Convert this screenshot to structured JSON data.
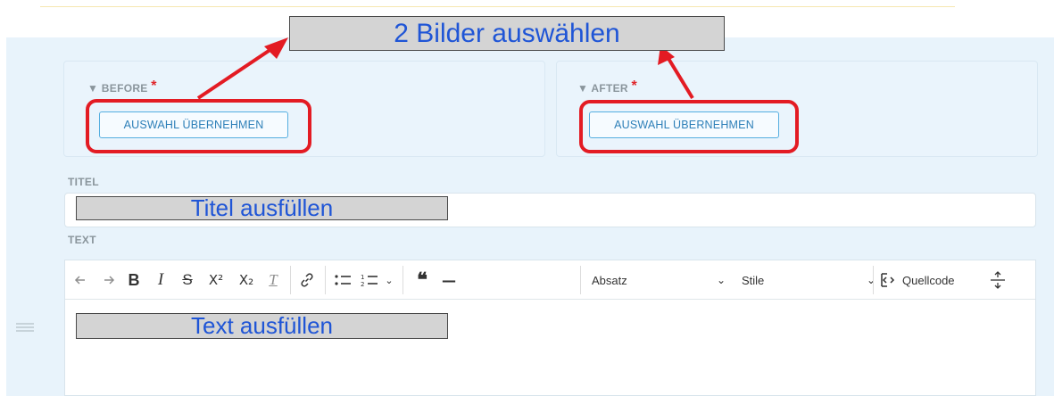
{
  "callouts": {
    "images": "2 Bilder auswählen",
    "title": "Titel ausfüllen",
    "text": "Text ausfüllen"
  },
  "before": {
    "label": "▼ BEFORE",
    "required": "*",
    "button_label": "AUSWAHL ÜBERNEHMEN"
  },
  "after": {
    "label": "▼ AFTER",
    "required": "*",
    "button_label": "AUSWAHL ÜBERNEHMEN"
  },
  "title_section": {
    "label": "TITEL",
    "value": ""
  },
  "text_section": {
    "label": "TEXT"
  },
  "toolbar": {
    "undo_icon": "undo-icon",
    "redo_icon": "redo-icon",
    "bold": "B",
    "italic": "I",
    "strike": "S",
    "superscript": "X²",
    "subscript": "X₂",
    "clear_format": "T",
    "link_icon": "link-icon",
    "bullet_icon": "bulleted-list-icon",
    "numbered_icon": "numbered-list-icon",
    "quote": "❝",
    "hr": "—",
    "paragraph_select": "Absatz",
    "styles_select": "Stile",
    "source_label": "Quellcode",
    "page_break_icon": "page-break-icon"
  },
  "colors": {
    "panel_bg": "#e8f3fb",
    "highlight_red": "#e31b23",
    "callout_blue": "#1f55d6",
    "button_border": "#55aee0"
  }
}
